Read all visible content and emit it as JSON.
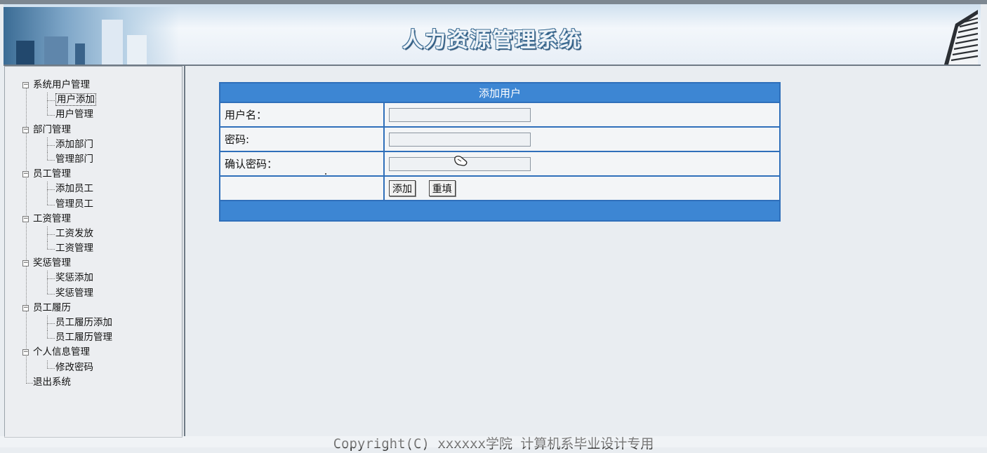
{
  "header": {
    "title": "人力资源管理系统",
    "accent_color": "#3d86d3",
    "border_color": "#6f7a85"
  },
  "sidebar": {
    "groups": [
      {
        "label": "系统用户管理",
        "children": [
          "用户添加",
          "用户管理"
        ]
      },
      {
        "label": "部门管理",
        "children": [
          "添加部门",
          "管理部门"
        ]
      },
      {
        "label": "员工管理",
        "children": [
          "添加员工",
          "管理员工"
        ]
      },
      {
        "label": "工资管理",
        "children": [
          "工资发放",
          "工资管理"
        ]
      },
      {
        "label": "奖惩管理",
        "children": [
          "奖惩添加",
          "奖惩管理"
        ]
      },
      {
        "label": "员工履历",
        "children": [
          "员工履历添加",
          "员工履历管理"
        ]
      },
      {
        "label": "个人信息管理",
        "children": [
          "修改密码"
        ]
      }
    ],
    "exit_label": "退出系统",
    "selected_item": "用户添加",
    "expander_glyph": "−"
  },
  "form": {
    "caption": "添加用户",
    "fields": [
      {
        "label": "用户名：",
        "value": "",
        "type": "text"
      },
      {
        "label": "密码:",
        "value": "",
        "type": "password"
      },
      {
        "label": "确认密码：",
        "value": "",
        "type": "password"
      }
    ],
    "buttons": {
      "submit": "添加",
      "reset": "重填"
    }
  },
  "footer": {
    "copyright": "Copyright(C) xxxxxx学院 计算机系毕业设计专用"
  },
  "icons": {
    "cursor": "hand-pointer-icon"
  }
}
